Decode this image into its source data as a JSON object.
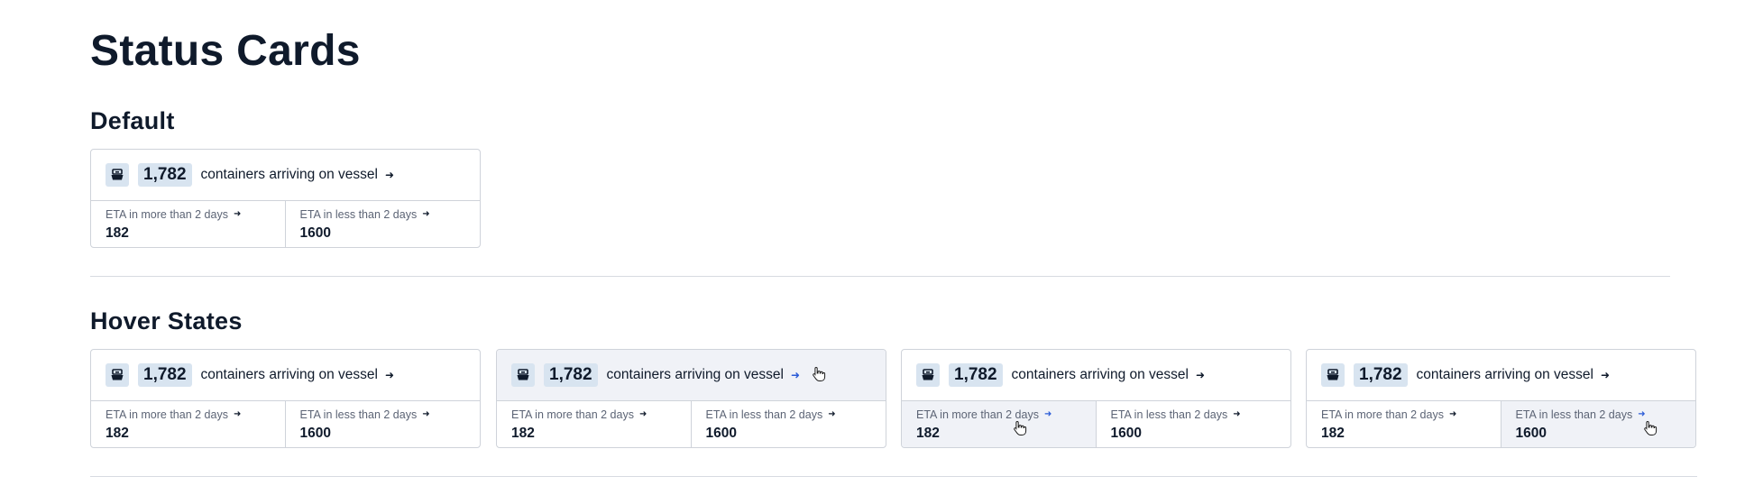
{
  "page": {
    "title": "Status Cards"
  },
  "sections": {
    "default": {
      "title": "Default"
    },
    "hover": {
      "title": "Hover States"
    }
  },
  "card": {
    "count": "1,782",
    "label": "containers arriving on vessel",
    "eta_more_label": "ETA in more than 2 days",
    "eta_more_value": "182",
    "eta_less_label": "ETA in less than 2 days",
    "eta_less_value": "1600",
    "icon": "vessel-icon"
  },
  "colors": {
    "hover_background": "#f0f2f7",
    "hover_arrow": "#2a5bd7",
    "badge_background": "#d8e4f0",
    "border": "#cfd3da"
  }
}
